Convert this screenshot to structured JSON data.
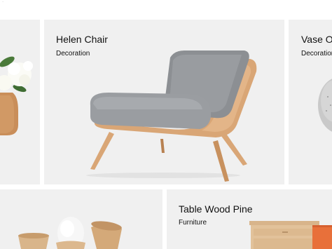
{
  "top_mark": "~",
  "products": [
    {
      "title": "Helen Chair",
      "category": "Decoration"
    },
    {
      "title": "Vase Of",
      "category": "Decoration"
    },
    {
      "title": "Table Wood Pine",
      "category": "Furniture"
    }
  ],
  "colors": {
    "page_background": "#ffffff",
    "card_background": "#f0f0f0",
    "chair_wood": "#d9a676",
    "chair_cushion": "#8c8f93",
    "vase_wood": "#c98e5a",
    "cabinet_accent": "#e8703a"
  }
}
